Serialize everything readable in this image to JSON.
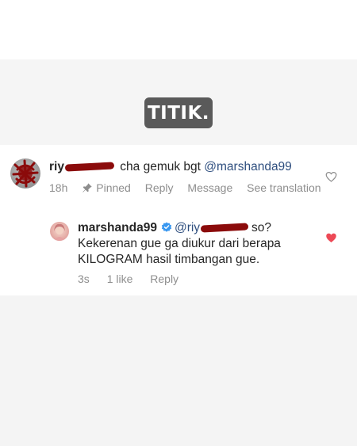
{
  "story_label": "TITIK.",
  "comment": {
    "username_prefix": "riy",
    "text": "cha gemuk bgt",
    "mention": "@marshanda99",
    "time": "18h",
    "pinned_label": "Pinned",
    "reply_label": "Reply",
    "message_label": "Message",
    "translation_label": "See translation",
    "liked": false
  },
  "reply": {
    "username": "marshanda99",
    "mention_prefix": "@riy",
    "text_line1_suffix": "so?",
    "text_line2": "Kekerenan gue ga diukur dari berapa",
    "text_line3": "KILOGRAM hasil timbangan gue.",
    "time": "3s",
    "likes_label": "1 like",
    "reply_label": "Reply",
    "liked": true
  },
  "colors": {
    "heart_liked": "#ed4956",
    "mention": "#2f4f7f",
    "meta": "#8e8e8e",
    "verified": "#3897f0",
    "redaction": "#8b0b0b"
  },
  "icons": {
    "pin": "pin-icon",
    "verified": "verified-badge-icon",
    "heart_outline": "heart-outline-icon",
    "heart_filled": "heart-filled-icon"
  }
}
